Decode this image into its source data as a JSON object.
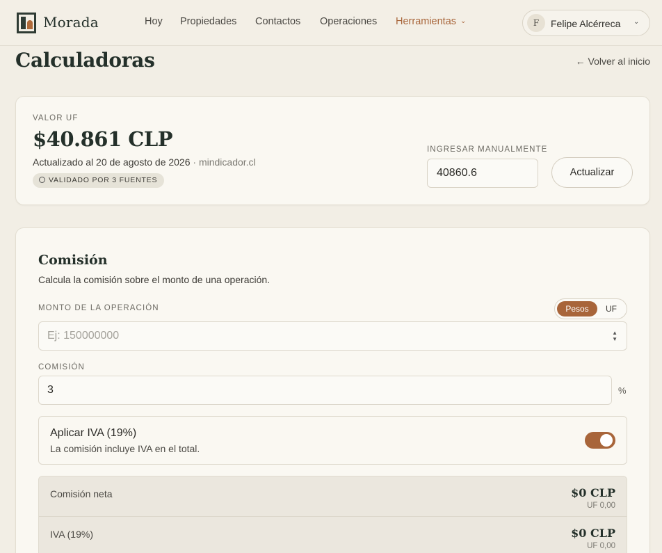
{
  "brand": "Morada",
  "nav": {
    "items": [
      "Hoy",
      "Propiedades",
      "Contactos",
      "Operaciones"
    ],
    "active": "Herramientas"
  },
  "user": {
    "initial": "F",
    "name": "Felipe Alcérreca"
  },
  "page": {
    "title": "Calculadoras",
    "back": "← Volver al inicio"
  },
  "uf": {
    "label": "VALOR UF",
    "value": "$40.861 CLP",
    "updated": "Actualizado al 20 de agosto de 2026",
    "source": " · mindicador.cl",
    "badge": "VALIDADO POR 3 FUENTES",
    "manual_label": "INGRESAR MANUALMENTE",
    "manual_value": "40860.6",
    "update_button": "Actualizar"
  },
  "comision": {
    "title": "Comisión",
    "description": "Calcula la comisión sobre el monto de una operación.",
    "monto_label": "MONTO DE LA OPERACIÓN",
    "currency_options": [
      "Pesos",
      "UF"
    ],
    "currency_selected": "Pesos",
    "monto_placeholder": "Ej: 150000000",
    "comision_label": "COMISIÓN",
    "comision_value": "3",
    "percent_sign": "%",
    "iva_title": "Aplicar IVA (19%)",
    "iva_sub": "La comisión incluye IVA en el total.",
    "iva_enabled": true,
    "summary": [
      {
        "label": "Comisión neta",
        "clp": "$0 CLP",
        "uf": "UF 0,00"
      },
      {
        "label": "IVA (19%)",
        "clp": "$0 CLP",
        "uf": "UF 0,00"
      }
    ]
  },
  "colors": {
    "accent": "#a8653a",
    "background": "#f2eee5",
    "dark": "#24302a"
  }
}
